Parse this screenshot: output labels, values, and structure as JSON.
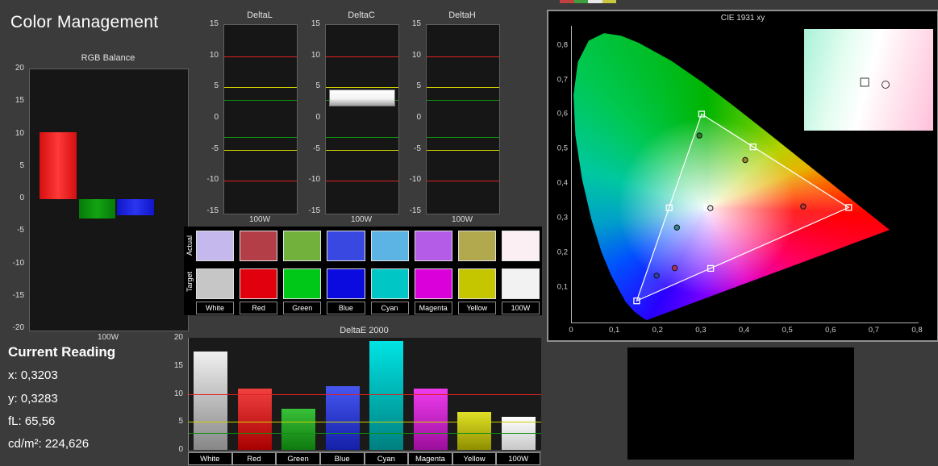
{
  "page": {
    "title": "Color Management"
  },
  "top_fragment_colors": [
    "#c04040",
    "#3da03d",
    "#e8e8e8",
    "#c8c840"
  ],
  "rgb_balance": {
    "title": "RGB Balance",
    "x_label": "100W",
    "type": "bar",
    "ylim": [
      -20,
      20
    ],
    "yticks": [
      20,
      15,
      10,
      5,
      0,
      -5,
      -10,
      -15,
      -20
    ],
    "bars": [
      {
        "name": "red",
        "value": 10.3,
        "color": "#d40f0f",
        "color_hi": "#ff3838"
      },
      {
        "name": "green",
        "value": -3.0,
        "color": "#077a07",
        "color_hi": "#12a512"
      },
      {
        "name": "blue",
        "value": -2.5,
        "color": "#1015c8",
        "color_hi": "#2b36f0"
      }
    ]
  },
  "delta_common": {
    "ylim": [
      -15,
      15
    ],
    "yticks": [
      15,
      10,
      5,
      0,
      -5,
      -10,
      -15
    ],
    "ref_lines": [
      {
        "value": 10,
        "color": "#e02020"
      },
      {
        "value": 5,
        "color": "#cdd000"
      },
      {
        "value": 3,
        "color": "#0f8f0f"
      },
      {
        "value": -3,
        "color": "#0f8f0f"
      },
      {
        "value": -5,
        "color": "#cdd000"
      },
      {
        "value": -10,
        "color": "#e02020"
      }
    ]
  },
  "delta_charts": [
    {
      "title": "DeltaL",
      "x_label": "100W",
      "bar": null
    },
    {
      "title": "DeltaC",
      "x_label": "100W",
      "bar": {
        "from": 2.2,
        "to": 4.6
      }
    },
    {
      "title": "DeltaH",
      "x_label": "100W",
      "bar": null
    }
  ],
  "swatches": {
    "row_labels": [
      "Actual",
      "Target"
    ],
    "columns": [
      "White",
      "Red",
      "Green",
      "Blue",
      "Cyan",
      "Magenta",
      "Yellow",
      "100W"
    ],
    "actual": [
      "#c4b8ec",
      "#b43e48",
      "#72b23c",
      "#3848e0",
      "#5cb4e4",
      "#b45ce8",
      "#b2a84e",
      "#fceff3"
    ],
    "target": [
      "#c6c6c6",
      "#e1000e",
      "#00c818",
      "#0b0bdf",
      "#00c6c6",
      "#d900d9",
      "#c6c600",
      "#f2f2f2"
    ]
  },
  "delta_e": {
    "title": "DeltaE 2000",
    "type": "bar",
    "categories": [
      "White",
      "Red",
      "Green",
      "Blue",
      "Cyan",
      "Magenta",
      "Yellow",
      "100W"
    ],
    "values": [
      17.6,
      11.0,
      7.3,
      11.4,
      19.4,
      10.9,
      6.8,
      5.9
    ],
    "colors": [
      [
        "#f0f0f0",
        "#878787"
      ],
      [
        "#f04040",
        "#a80000"
      ],
      [
        "#38c038",
        "#0e7a0e"
      ],
      [
        "#4656f0",
        "#1420a8"
      ],
      [
        "#00e4e4",
        "#008080"
      ],
      [
        "#ee3cee",
        "#9c0e9c"
      ],
      [
        "#e0e028",
        "#8f8f00"
      ],
      [
        "#ffffff",
        "#c8c8c8"
      ]
    ],
    "ylim": [
      0,
      20
    ],
    "yticks": [
      20,
      15,
      10,
      5,
      0
    ],
    "ref_lines": [
      {
        "value": 10,
        "color": "#e02020"
      },
      {
        "value": 5,
        "color": "#cdd000"
      },
      {
        "value": 3,
        "color": "#0f8f0f"
      }
    ]
  },
  "current_reading": {
    "heading": "Current Reading",
    "lines": [
      "x: 0,3203",
      "y: 0,3283",
      "fL: 65,56",
      "cd/m²: 224,626"
    ]
  },
  "cie": {
    "title": "CIE 1931 xy",
    "xlim": [
      0,
      0.8
    ],
    "ylim": [
      0,
      0.855
    ],
    "xtick_labels": [
      "0",
      "0,1",
      "0,2",
      "0,3",
      "0,4",
      "0,5",
      "0,6",
      "0,7",
      "0,8"
    ],
    "ytick_labels": [
      "0,1",
      "0,2",
      "0,3",
      "0,4",
      "0,5",
      "0,6",
      "0,7",
      "0,8"
    ],
    "target_triangle": [
      [
        0.64,
        0.33
      ],
      [
        0.3,
        0.6
      ],
      [
        0.15,
        0.06
      ]
    ],
    "target_points": [
      {
        "name": "white",
        "x": 0.3127,
        "y": 0.329
      },
      {
        "name": "red",
        "x": 0.64,
        "y": 0.33
      },
      {
        "name": "green",
        "x": 0.3,
        "y": 0.6
      },
      {
        "name": "blue",
        "x": 0.15,
        "y": 0.06
      },
      {
        "name": "cyan",
        "x": 0.225,
        "y": 0.329
      },
      {
        "name": "magenta",
        "x": 0.321,
        "y": 0.154
      },
      {
        "name": "yellow",
        "x": 0.419,
        "y": 0.505
      }
    ],
    "measured_points": [
      {
        "name": "white",
        "x": 0.3203,
        "y": 0.3283,
        "color": "#e8e8e8"
      },
      {
        "name": "red",
        "x": 0.535,
        "y": 0.333,
        "color": "#c03030"
      },
      {
        "name": "green",
        "x": 0.295,
        "y": 0.538,
        "color": "#2a7a2a"
      },
      {
        "name": "yellow",
        "x": 0.401,
        "y": 0.467,
        "color": "#9a8a20"
      },
      {
        "name": "cyan",
        "x": 0.243,
        "y": 0.272,
        "color": "#2a8a8a"
      },
      {
        "name": "magenta",
        "x": 0.238,
        "y": 0.155,
        "color": "#b03060"
      },
      {
        "name": "blue",
        "x": 0.196,
        "y": 0.133,
        "color": "#3040b0"
      }
    ],
    "inset_markers": {
      "square": {
        "x": 0.47,
        "y": 0.52
      },
      "circle": {
        "x": 0.63,
        "y": 0.55
      }
    }
  }
}
